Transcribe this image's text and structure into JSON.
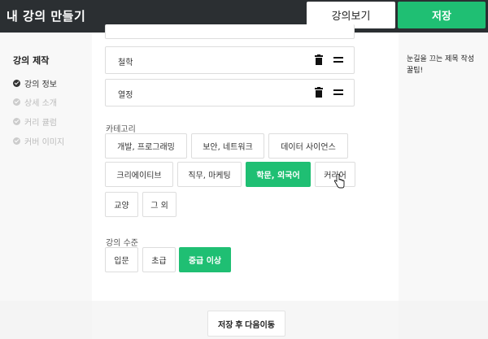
{
  "header": {
    "title": "내 강의 만들기",
    "view_label": "강의보기",
    "save_label": "저장"
  },
  "sidebar": {
    "title": "강의 제작",
    "items": [
      {
        "label": "강의 정보",
        "active": true
      },
      {
        "label": "상세 소개",
        "active": false
      },
      {
        "label": "커리 큘럼",
        "active": false
      },
      {
        "label": "커버 이미지",
        "active": false
      }
    ]
  },
  "list_items": [
    {
      "label": "철학"
    },
    {
      "label": "열정"
    }
  ],
  "category": {
    "label": "카테고리",
    "options": [
      {
        "label": "개발, 프로그래밍",
        "selected": false
      },
      {
        "label": "보안, 네트워크",
        "selected": false
      },
      {
        "label": "데이터 사이언스",
        "selected": false
      },
      {
        "label": "크리에이티브",
        "selected": false
      },
      {
        "label": "직무, 마케팅",
        "selected": false
      },
      {
        "label": "학문, 외국어",
        "selected": true
      },
      {
        "label": "커리어",
        "selected": false
      },
      {
        "label": "교양",
        "selected": false
      },
      {
        "label": "그 외",
        "selected": false
      }
    ]
  },
  "level": {
    "label": "강의 수준",
    "options": [
      {
        "label": "입문",
        "selected": false
      },
      {
        "label": "초급",
        "selected": false
      },
      {
        "label": "중급 이상",
        "selected": true
      }
    ]
  },
  "tip": {
    "text": "눈길을 끄는 제목 작성 꿀팁!"
  },
  "footer": {
    "next_label": "저장 후 다음이동"
  },
  "colors": {
    "accent": "#1fbf73",
    "topbar": "#2b2f32"
  }
}
